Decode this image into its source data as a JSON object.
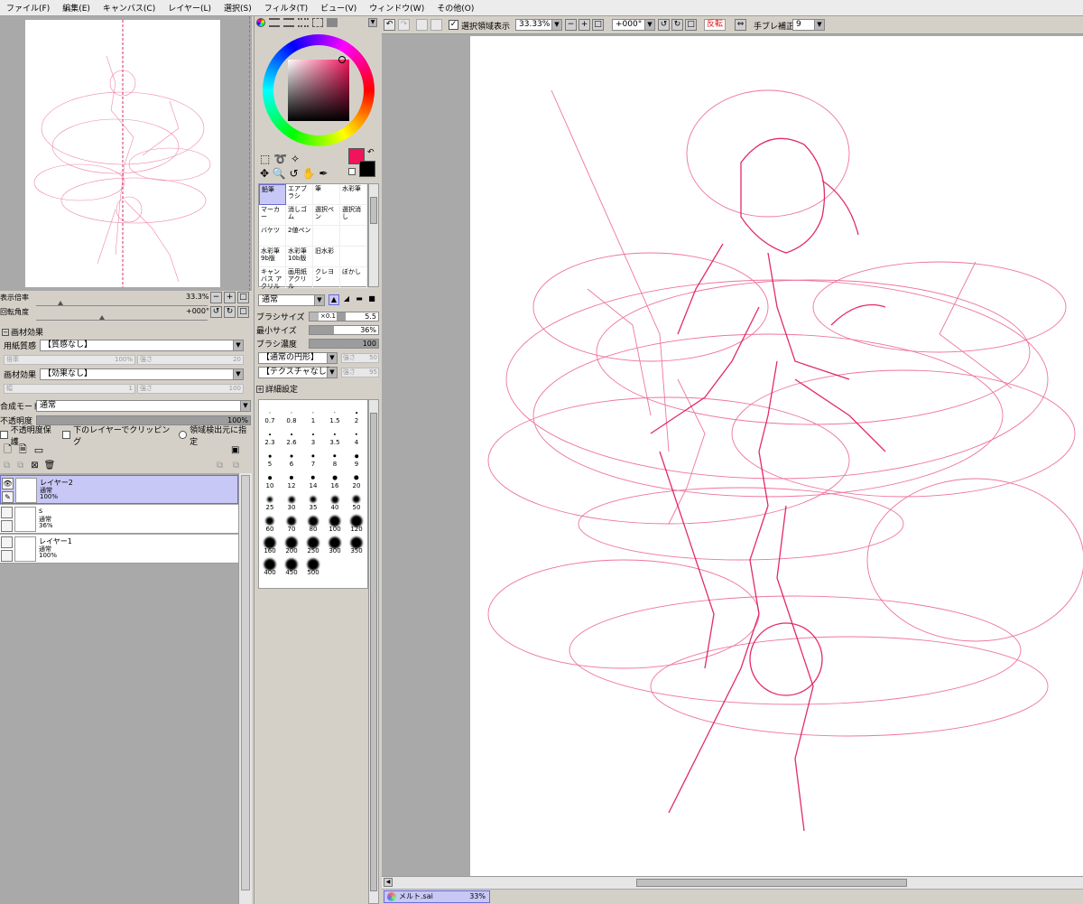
{
  "menu": [
    "ファイル(F)",
    "編集(E)",
    "キャンバス(C)",
    "レイヤー(L)",
    "選択(S)",
    "フィルタ(T)",
    "ビュー(V)",
    "ウィンドウ(W)",
    "その他(O)"
  ],
  "navigator": {
    "zoom_label": "表示倍率",
    "zoom_value": "33.3%",
    "angle_label": "回転角度",
    "angle_value": "+000°"
  },
  "paper_effects": {
    "header": "画材効果",
    "texture_label": "用紙質感",
    "texture_value": "【質感なし】",
    "texture_scale_label": "倍率",
    "texture_scale_value": "100%",
    "texture_strength_label": "強さ",
    "texture_strength_value": "20",
    "effect_label": "画材効果",
    "effect_value": "【効果なし】",
    "effect_width_label": "幅",
    "effect_width_value": "1",
    "effect_strength_label": "強さ",
    "effect_strength_value": "100"
  },
  "layer_props": {
    "blend_label": "合成モード",
    "blend_value": "通常",
    "opacity_label": "不透明度",
    "opacity_value": "100%",
    "opacity_fraction": 1.0,
    "preserve_opacity": "不透明度保護",
    "clip_below": "下のレイヤーでクリッピング",
    "selection_source": "領域検出元に指定"
  },
  "layers": [
    {
      "name": "レイヤー2",
      "mode": "通常",
      "opacity": "100%",
      "selected": true,
      "visible": true
    },
    {
      "name": "s",
      "mode": "通常",
      "opacity": "36%",
      "selected": false,
      "visible": false
    },
    {
      "name": "レイヤー1",
      "mode": "通常",
      "opacity": "100%",
      "selected": false,
      "visible": false
    }
  ],
  "colors": {
    "primary": "#f0145a",
    "secondary": "#000000",
    "accent_select": "#c8c8f6"
  },
  "tools": [
    {
      "label": "鉛筆",
      "selected": true
    },
    {
      "label": "エアブラシ",
      "selected": false
    },
    {
      "label": "筆",
      "selected": false
    },
    {
      "label": "水彩筆",
      "selected": false
    },
    {
      "label": "マーカー",
      "selected": false
    },
    {
      "label": "消しゴム",
      "selected": false
    },
    {
      "label": "選択ペン",
      "selected": false
    },
    {
      "label": "選択消し",
      "selected": false
    },
    {
      "label": "バケツ",
      "selected": false
    },
    {
      "label": "2値ペン",
      "selected": false
    },
    {
      "label": "",
      "selected": false
    },
    {
      "label": "",
      "selected": false
    },
    {
      "label": "水彩筆 9b版",
      "selected": false
    },
    {
      "label": "水彩筆 10b版",
      "selected": false
    },
    {
      "label": "旧水彩",
      "selected": false
    },
    {
      "label": "",
      "selected": false
    },
    {
      "label": "キャンバス アクリル",
      "selected": false
    },
    {
      "label": "画用紙 アクリル",
      "selected": false
    },
    {
      "label": "クレヨン",
      "selected": false
    },
    {
      "label": "ぼかし",
      "selected": false
    }
  ],
  "brush": {
    "mode_value": "通常",
    "size_label": "ブラシサイズ",
    "size_multiplier": "×0.1",
    "size_value": "5.5",
    "min_size_label": "最小サイズ",
    "min_size_value": "36%",
    "min_size_fraction": 0.36,
    "density_label": "ブラシ濃度",
    "density_value": "100",
    "density_fraction": 1.0,
    "shape_value": "【通常の円形】",
    "shape_strength_label": "強さ",
    "shape_strength_value": "50",
    "texture_value": "【テクスチャなし】",
    "texture_strength_label": "強さ",
    "texture_strength_value": "95",
    "advanced_label": "詳細設定"
  },
  "brush_sizes": [
    "0.7",
    "0.8",
    "1",
    "1.5",
    "2",
    "2.3",
    "2.6",
    "3",
    "3.5",
    "4",
    "5",
    "6",
    "7",
    "8",
    "9",
    "10",
    "12",
    "14",
    "16",
    "20",
    "25",
    "30",
    "35",
    "40",
    "50",
    "60",
    "70",
    "80",
    "100",
    "120",
    "160",
    "200",
    "250",
    "300",
    "350",
    "400",
    "450",
    "500"
  ],
  "canvas_toolbar": {
    "show_selection": "選択領域表示",
    "zoom": "33.33%",
    "angle": "+000°",
    "flip": "反転",
    "stabilizer_label": "手ブレ補正",
    "stabilizer_value": "9"
  },
  "document_tab": {
    "name": "メルト.sai",
    "zoom": "33%"
  }
}
